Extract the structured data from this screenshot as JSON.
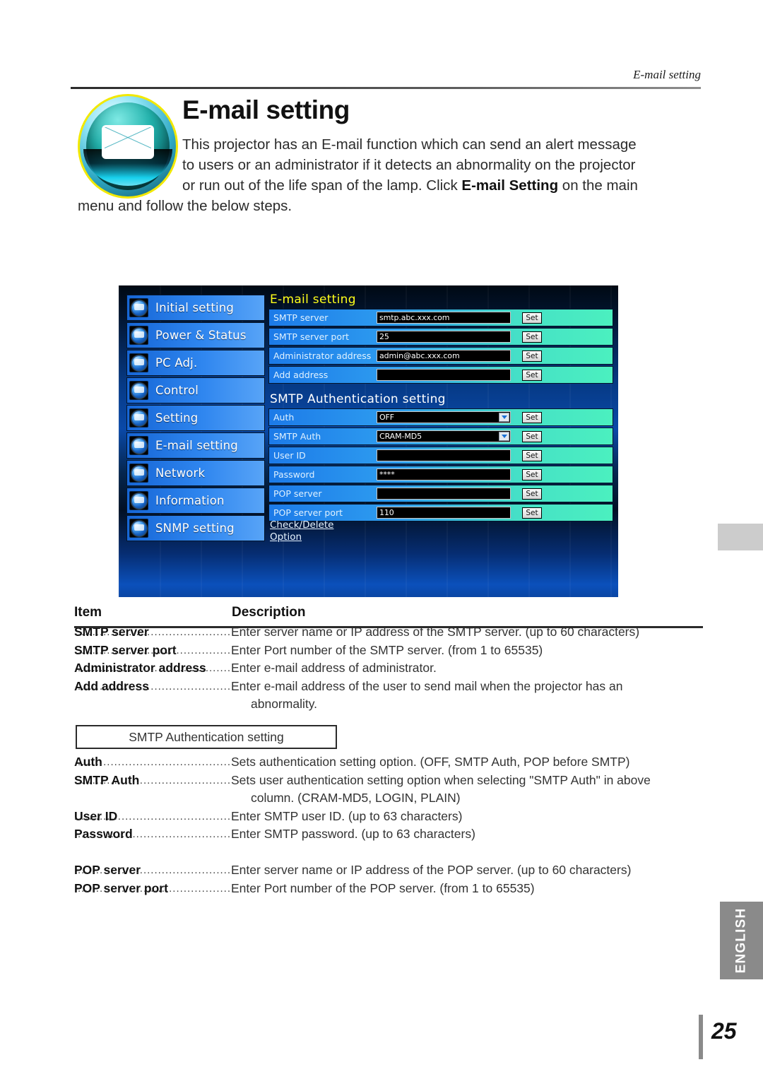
{
  "running_head": "E-mail setting",
  "page_title": "E-mail setting",
  "intro": {
    "line1": "This projector has an E-mail function which can send an alert message",
    "line2": "to users or an administrator if it detects an abnormality on the projector",
    "line3_a": "or run out of the life span of the lamp. Click ",
    "line3_bold": "E-mail Setting",
    "line3_b": " on the main",
    "line4": "menu and follow the below steps."
  },
  "screenshot": {
    "sidebar": [
      {
        "label": "Initial setting",
        "icon": "globe-gear-icon"
      },
      {
        "label": "Power & Status",
        "icon": "globe-power-icon"
      },
      {
        "label": "PC Adj.",
        "icon": "globe-monitor-icon"
      },
      {
        "label": "Control",
        "icon": "globe-control-icon"
      },
      {
        "label": "Setting",
        "icon": "globe-setting-icon"
      },
      {
        "label": "E-mail setting",
        "icon": "globe-envelope-icon"
      },
      {
        "label": "Network",
        "icon": "globe-network-icon"
      },
      {
        "label": "Information",
        "icon": "globe-info-icon"
      },
      {
        "label": "SNMP setting",
        "icon": "globe-snmp-icon"
      }
    ],
    "section1_title": "E-mail setting",
    "section2_title": "SMTP Authentication setting",
    "set_label": "Set",
    "fields": [
      {
        "label": "SMTP server",
        "value": "smtp.abc.xxx.com",
        "type": "text"
      },
      {
        "label": "SMTP server port",
        "value": "25",
        "type": "text"
      },
      {
        "label": "Administrator address",
        "value": "admin@abc.xxx.com",
        "type": "text"
      },
      {
        "label": "Add address",
        "value": "",
        "type": "text"
      }
    ],
    "auth_fields": [
      {
        "label": "Auth",
        "value": "OFF",
        "type": "select"
      },
      {
        "label": "SMTP Auth",
        "value": "CRAM-MD5",
        "type": "select"
      },
      {
        "label": "User ID",
        "value": "",
        "type": "text"
      },
      {
        "label": "Password",
        "value": "****",
        "type": "text"
      },
      {
        "label": "POP server",
        "value": "",
        "type": "text"
      },
      {
        "label": "POP server port",
        "value": "110",
        "type": "text"
      }
    ],
    "links": [
      {
        "label": "Check/Delete"
      },
      {
        "label": "Option"
      }
    ]
  },
  "table": {
    "header_item": "Item",
    "header_description": "Description",
    "group1": [
      {
        "item": "SMTP server",
        "desc": "Enter server name or IP address of the SMTP server. (up to 60 characters)"
      },
      {
        "item": "SMTP server port",
        "desc": "Enter Port number of the SMTP server. (from 1 to 65535)"
      },
      {
        "item": "Administrator address",
        "desc": "Enter e-mail address of administrator."
      },
      {
        "item": "Add address",
        "desc": "Enter e-mail address of the user to send mail when the projector has an",
        "desc_cont": "abnormality."
      }
    ],
    "auth_box_label": "SMTP Authentication setting",
    "group2": [
      {
        "item": "Auth",
        "desc": "Sets authentication setting option. (OFF, SMTP Auth, POP before SMTP)"
      },
      {
        "item": "SMTP Auth",
        "desc": "Sets user authentication setting option when selecting \"SMTP Auth\" in above",
        "desc_cont": "column. (CRAM-MD5, LOGIN, PLAIN)"
      },
      {
        "item": "User ID",
        "desc": "Enter SMTP user ID. (up to 63 characters)"
      },
      {
        "item": "Password",
        "desc": "Enter SMTP password. (up to 63 characters)"
      }
    ],
    "group3": [
      {
        "item": "POP server",
        "desc": "Enter server name or IP address of the POP server. (up to 60 characters)"
      },
      {
        "item": "POP server port",
        "desc": "Enter Port number of the POP server. (from 1 to 65535)"
      }
    ]
  },
  "margin": {
    "language_tab": "ENGLISH",
    "page_number": "25"
  },
  "colors": {
    "accent_yellow": "#ffff1a",
    "panel_blue": "#1c7ae8",
    "panel_teal": "#4bf0bf",
    "tab_gray": "#8a8a8a"
  }
}
